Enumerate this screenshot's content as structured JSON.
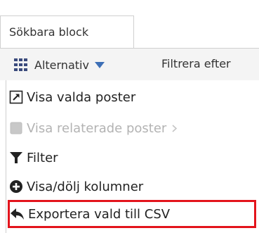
{
  "tab": {
    "label": "Sökbara block"
  },
  "toolbar": {
    "options_label": "Alternativ",
    "filter_label": "Filtrera efter"
  },
  "menu": {
    "items": [
      {
        "label": "Visa valda poster",
        "icon": "external-link-icon",
        "enabled": true
      },
      {
        "label": "Visa relaterade poster",
        "icon": "checkbox-icon",
        "enabled": false,
        "has_submenu": true
      },
      {
        "label": "Filter",
        "icon": "funnel-icon",
        "enabled": true
      },
      {
        "label": "Visa/dölj kolumner",
        "icon": "plus-circle-icon",
        "enabled": true
      },
      {
        "label": "Exportera vald till CSV",
        "icon": "reply-arrow-icon",
        "enabled": true,
        "highlighted": true
      }
    ]
  },
  "colors": {
    "highlight": "#e3141c",
    "toolbar_bg": "#f4f4f4",
    "border": "#cfcfcf",
    "disabled_text": "#b3b3b3",
    "grid_icon": "#3a4a7c"
  }
}
